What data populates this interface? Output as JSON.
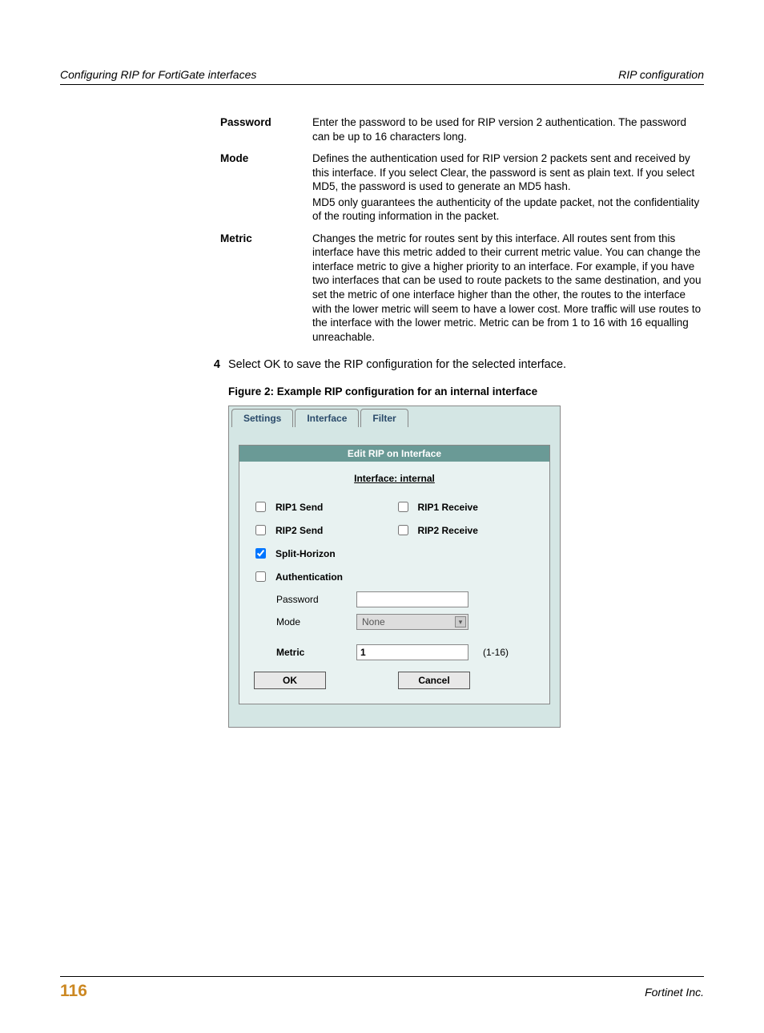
{
  "header": {
    "left": "Configuring RIP for FortiGate interfaces",
    "right": "RIP configuration"
  },
  "definitions": [
    {
      "term": "Password",
      "desc": [
        "Enter the password to be used for RIP version 2 authentication. The password can be up to 16 characters long."
      ]
    },
    {
      "term": "Mode",
      "desc": [
        "Defines the authentication used for RIP version 2 packets sent and received by this interface. If you select Clear, the password is sent as plain text. If you select MD5, the password is used to generate an MD5 hash.",
        "MD5 only guarantees the authenticity of the update packet, not the confidentiality of the routing information in the packet."
      ]
    },
    {
      "term": "Metric",
      "desc": [
        "Changes the metric for routes sent by this interface. All routes sent from this interface have this metric added to their current metric value. You can change the interface metric to give a higher priority to an interface. For example, if you have two interfaces that can be used to route packets to the same destination, and you set the metric of one interface higher than the other, the routes to the interface with the lower metric will seem to have a lower cost. More traffic will use routes to the interface with the lower metric. Metric can be from 1 to 16 with 16 equalling unreachable."
      ]
    }
  ],
  "step": {
    "num": "4",
    "text": "Select OK to save the RIP configuration for the selected interface."
  },
  "figure_caption": "Figure 2:   Example RIP configuration for an internal interface",
  "ui": {
    "tabs": [
      "Settings",
      "Interface",
      "Filter"
    ],
    "panel_title": "Edit RIP on Interface",
    "interface_label": "Interface: internal",
    "checkboxes": {
      "rip1_send": "RIP1 Send",
      "rip1_receive": "RIP1 Receive",
      "rip2_send": "RIP2 Send",
      "rip2_receive": "RIP2 Receive",
      "split_horizon": "Split-Horizon",
      "authentication": "Authentication"
    },
    "fields": {
      "password_label": "Password",
      "password_value": "",
      "mode_label": "Mode",
      "mode_value": "None",
      "metric_label": "Metric",
      "metric_value": "1",
      "metric_range": "(1-16)"
    },
    "buttons": {
      "ok": "OK",
      "cancel": "Cancel"
    }
  },
  "footer": {
    "page": "116",
    "right": "Fortinet Inc."
  }
}
